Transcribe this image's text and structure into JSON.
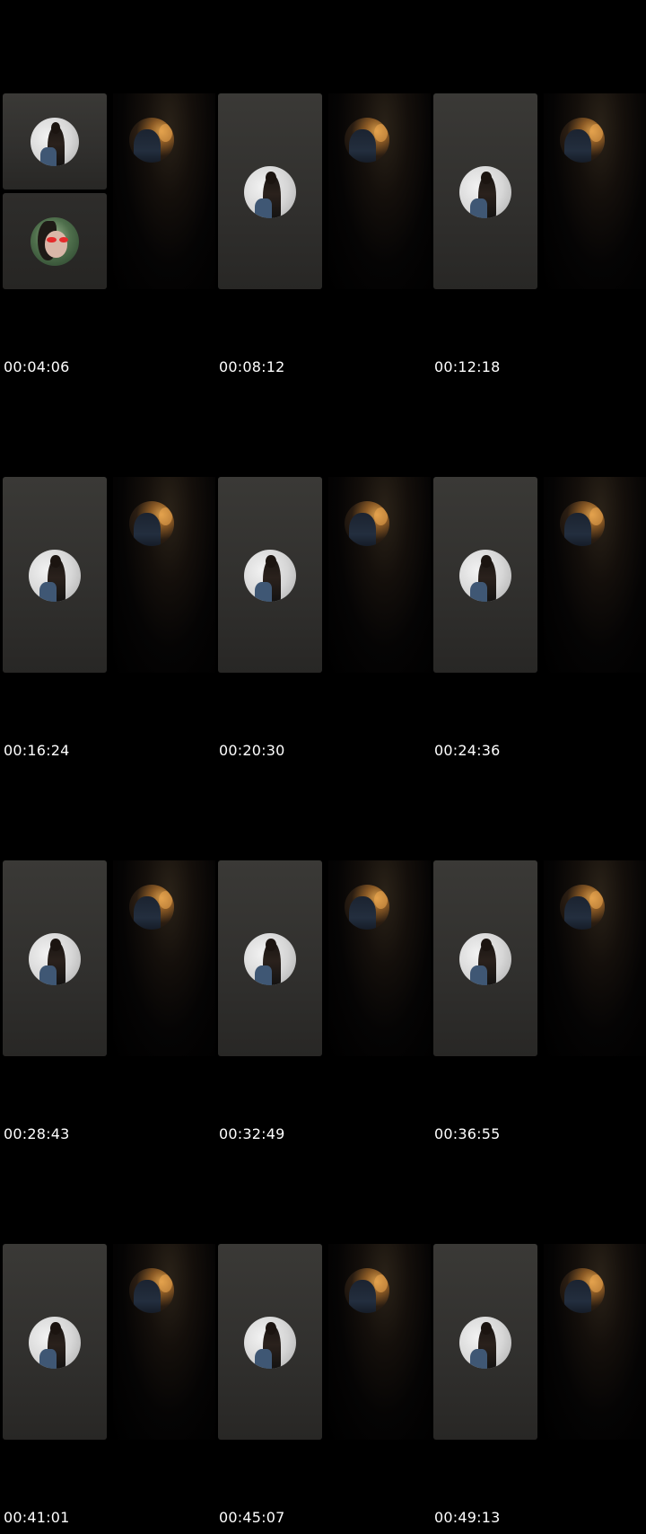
{
  "background_color": "#000000",
  "timestamp_color": "#ffffff",
  "frames": [
    {
      "timestamps": [
        "00:04:06",
        "00:08:12",
        "00:12:18"
      ]
    },
    {
      "timestamps": [
        "00:16:24",
        "00:20:30",
        "00:24:36"
      ]
    },
    {
      "timestamps": [
        "00:28:43",
        "00:32:49",
        "00:36:55"
      ]
    },
    {
      "timestamps": [
        "00:41:01",
        "00:45:07",
        "00:49:13"
      ]
    }
  ],
  "icons": {
    "participant_avatar": "woman-avatar-icon",
    "second_participant_avatar": "red-glasses-avatar-icon",
    "host_video_thumbnail": "host-video-thumbnail"
  }
}
